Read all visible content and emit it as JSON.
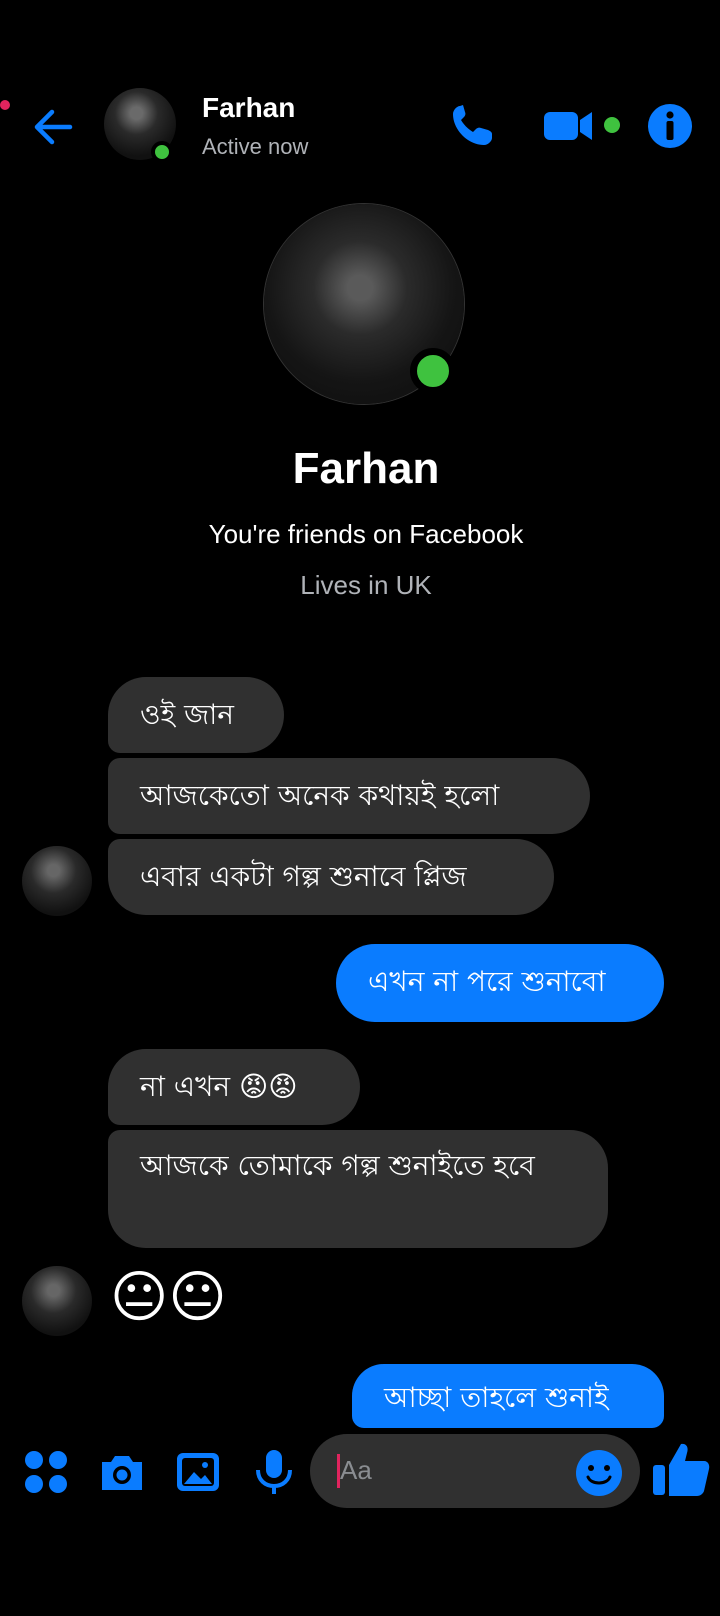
{
  "header": {
    "name": "Farhan",
    "status": "Active now"
  },
  "profile": {
    "name": "Farhan",
    "friends_line": "You're friends on Facebook",
    "lives_line": "Lives in UK"
  },
  "messages": [
    {
      "from": "them",
      "text": "ওই জান"
    },
    {
      "from": "them",
      "text": "আজকেতো অনেক কথায়ই হলো"
    },
    {
      "from": "them",
      "text": "এবার একটা গল্প শুনাবে প্লিজ"
    },
    {
      "from": "me",
      "text": "এখন না পরে শুনাবো"
    },
    {
      "from": "them",
      "text": "না এখন 😡😡"
    },
    {
      "from": "them",
      "text": "আজকে তোমাকে গল্প শুনাইতে হবে"
    },
    {
      "from": "them",
      "text": "😐😐"
    },
    {
      "from": "me",
      "text": "আচ্ছা তাহলে শুনাই"
    }
  ],
  "composer": {
    "placeholder": "Aa"
  },
  "colors": {
    "accent": "#0A7CFF",
    "online": "#3FC23F",
    "bubble_them": "#303030",
    "background": "#000000"
  },
  "icons": [
    "back-arrow-icon",
    "phone-icon",
    "video-camera-icon",
    "info-icon",
    "apps-grid-icon",
    "camera-icon",
    "gallery-icon",
    "microphone-icon",
    "emoji-icon",
    "thumbs-up-icon"
  ]
}
